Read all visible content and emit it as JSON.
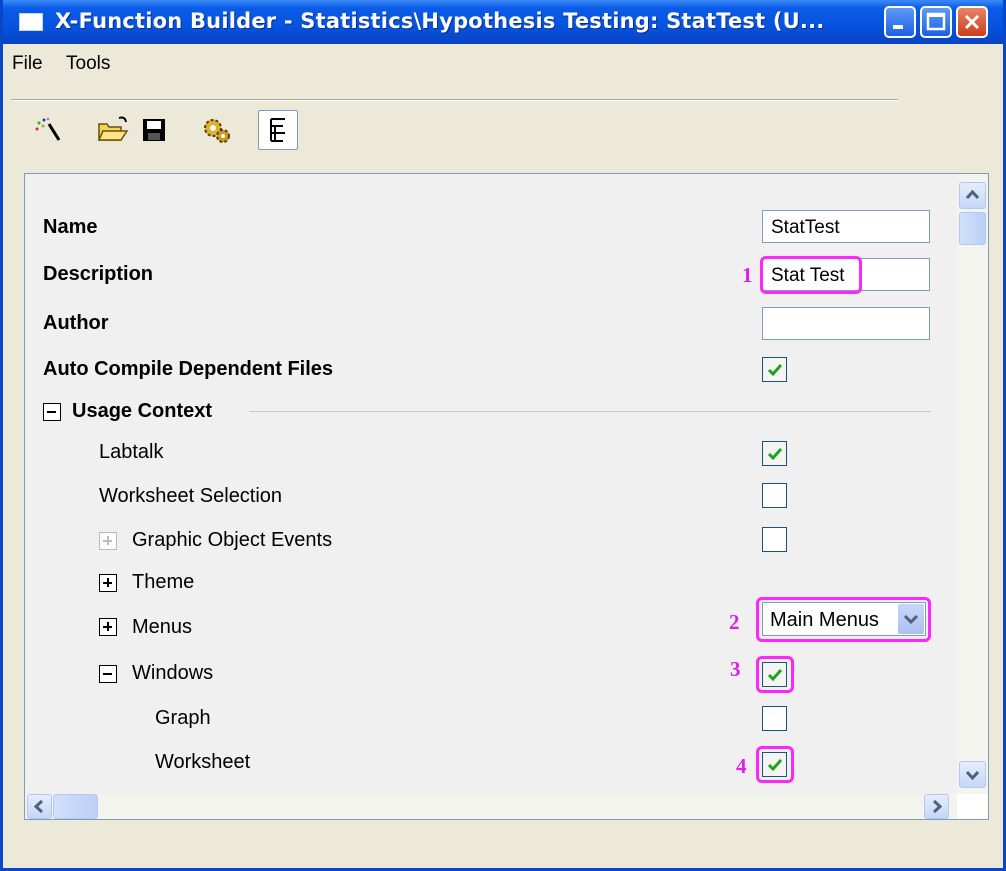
{
  "window": {
    "title": "X-Function Builder - Statistics\\Hypothesis Testing: StatTest (U..."
  },
  "menu": {
    "file": "File",
    "tools": "Tools"
  },
  "toolbar": {
    "icons": [
      "wizard-icon",
      "open-folder-icon",
      "save-icon",
      "gears-icon",
      "tree-view-icon"
    ]
  },
  "props": {
    "name_label": "Name",
    "name_value": "StatTest",
    "description_label": "Description",
    "description_value": "Stat Test",
    "author_label": "Author",
    "author_value": "",
    "auto_compile_label": "Auto Compile Dependent Files",
    "auto_compile_checked": true
  },
  "usage": {
    "header": "Usage Context",
    "labtalk_label": "Labtalk",
    "labtalk_checked": true,
    "worksheet_selection_label": "Worksheet Selection",
    "worksheet_selection_checked": false,
    "graphic_object_events_label": "Graphic Object Events",
    "graphic_object_events_checked": false,
    "theme_label": "Theme",
    "menus_label": "Menus",
    "menus_value": "Main Menus",
    "windows_label": "Windows",
    "windows_checked": true,
    "graph_label": "Graph",
    "graph_checked": false,
    "worksheet_label": "Worksheet",
    "worksheet_checked": true
  },
  "callouts": {
    "c1": "1",
    "c2": "2",
    "c3": "3",
    "c4": "4"
  },
  "colors": {
    "highlight": "#ff26ff",
    "titlebar": "#0653df",
    "check": "#21a121"
  }
}
